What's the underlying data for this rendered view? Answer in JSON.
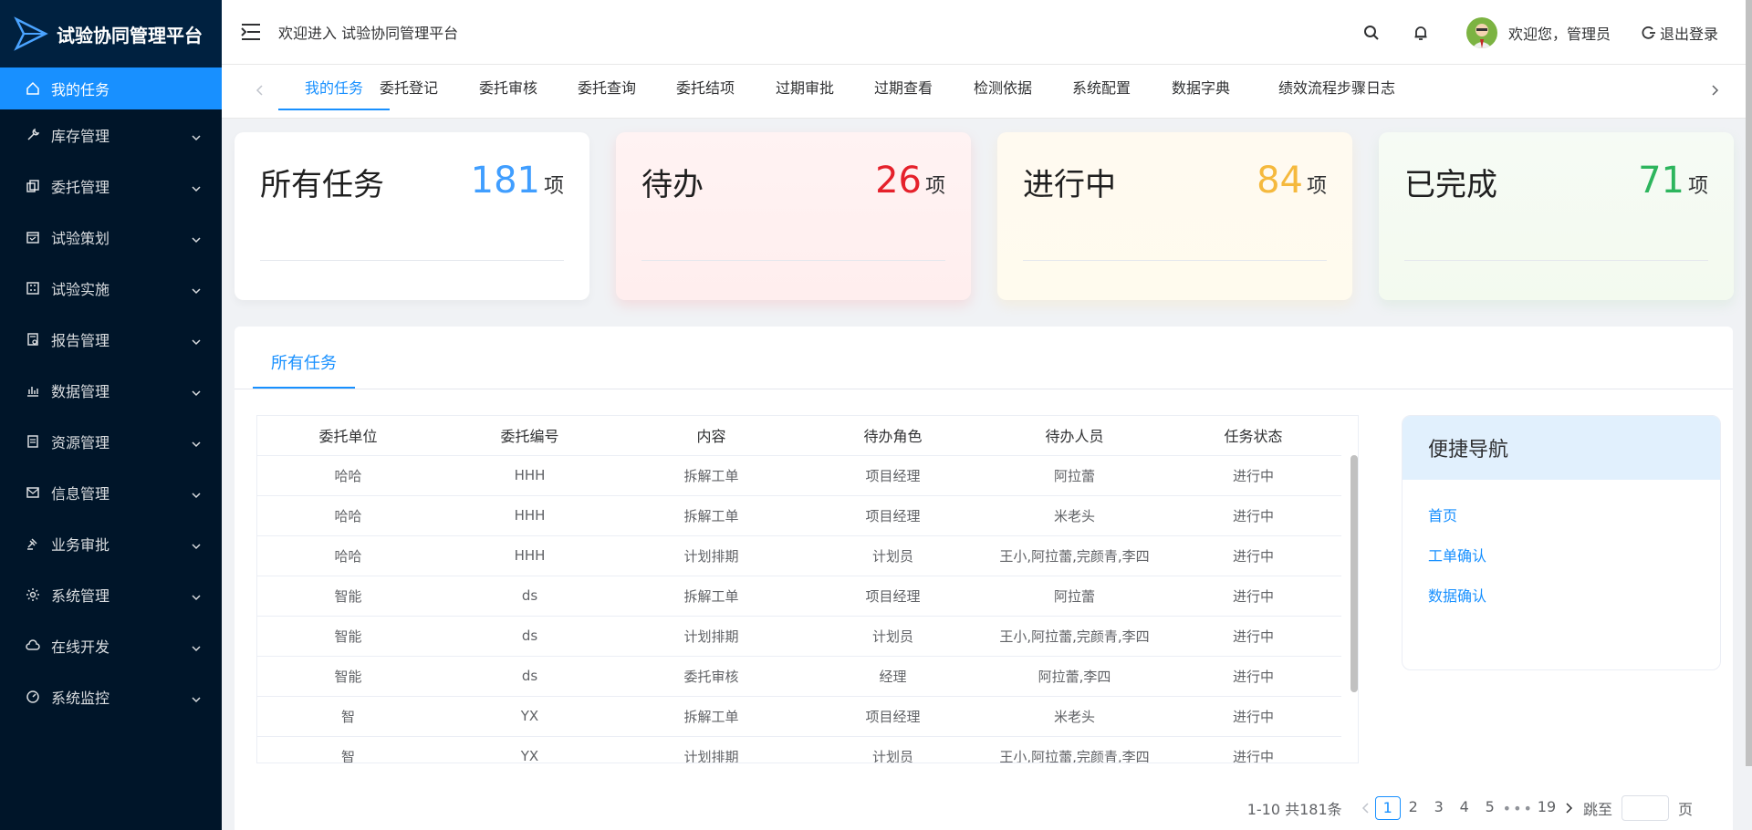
{
  "app": {
    "title": "试验协同管理平台",
    "welcome": "欢迎进入 试验协同管理平台"
  },
  "sidebar": {
    "items": [
      {
        "label": "我的任务",
        "icon": "home-icon"
      },
      {
        "label": "库存管理",
        "icon": "wrench-icon"
      },
      {
        "label": "委托管理",
        "icon": "copy-icon"
      },
      {
        "label": "试验策划",
        "icon": "calendar-icon"
      },
      {
        "label": "试验实施",
        "icon": "grid-icon"
      },
      {
        "label": "报告管理",
        "icon": "report-icon"
      },
      {
        "label": "数据管理",
        "icon": "bar-chart-icon"
      },
      {
        "label": "资源管理",
        "icon": "list-icon"
      },
      {
        "label": "信息管理",
        "icon": "mail-icon"
      },
      {
        "label": "业务审批",
        "icon": "gavel-icon"
      },
      {
        "label": "系统管理",
        "icon": "gear-icon"
      },
      {
        "label": "在线开发",
        "icon": "cloud-icon"
      },
      {
        "label": "系统监控",
        "icon": "dashboard-icon"
      }
    ]
  },
  "header": {
    "user_greet": "欢迎您，管理员",
    "logout": "退出登录"
  },
  "tabs": [
    "我的任务",
    "委托登记",
    "委托审核",
    "委托查询",
    "委托结项",
    "过期审批",
    "过期查看",
    "检测依据",
    "系统配置",
    "数据字典",
    "绩效流程步骤日志"
  ],
  "cards": [
    {
      "title": "所有任务",
      "count": "181",
      "unit": "项",
      "color": "#409eff"
    },
    {
      "title": "待办",
      "count": "26",
      "unit": "项",
      "color": "#e5212b"
    },
    {
      "title": "进行中",
      "count": "84",
      "unit": "项",
      "color": "#f5b93d"
    },
    {
      "title": "已完成",
      "count": "71",
      "unit": "项",
      "color": "#2db55d"
    }
  ],
  "panel": {
    "tab": "所有任务"
  },
  "table": {
    "headers": [
      "委托单位",
      "委托编号",
      "内容",
      "待办角色",
      "待办人员",
      "任务状态"
    ],
    "rows": [
      [
        "哈哈",
        "HHH",
        "拆解工单",
        "项目经理",
        "阿拉蕾",
        "进行中"
      ],
      [
        "哈哈",
        "HHH",
        "拆解工单",
        "项目经理",
        "米老头",
        "进行中"
      ],
      [
        "哈哈",
        "HHH",
        "计划排期",
        "计划员",
        "王小,阿拉蕾,完颜青,李四",
        "进行中"
      ],
      [
        "智能",
        "ds",
        "拆解工单",
        "项目经理",
        "阿拉蕾",
        "进行中"
      ],
      [
        "智能",
        "ds",
        "计划排期",
        "计划员",
        "王小,阿拉蕾,完颜青,李四",
        "进行中"
      ],
      [
        "智能",
        "ds",
        "委托审核",
        "经理",
        "阿拉蕾,李四",
        "进行中"
      ],
      [
        "智",
        "YX",
        "拆解工单",
        "项目经理",
        "米老头",
        "进行中"
      ],
      [
        "智",
        "YX",
        "计划排期",
        "计划员",
        "王小,阿拉蕾,完颜青,李四",
        "进行中"
      ]
    ]
  },
  "quick_nav": {
    "title": "便捷导航",
    "links": [
      "首页",
      "工单确认",
      "数据确认"
    ]
  },
  "pagination": {
    "total": "1-10 共181条",
    "pages": [
      "1",
      "2",
      "3",
      "4",
      "5"
    ],
    "more": "•••",
    "last": "19",
    "jump_label": "跳至",
    "page_suffix": "页"
  }
}
